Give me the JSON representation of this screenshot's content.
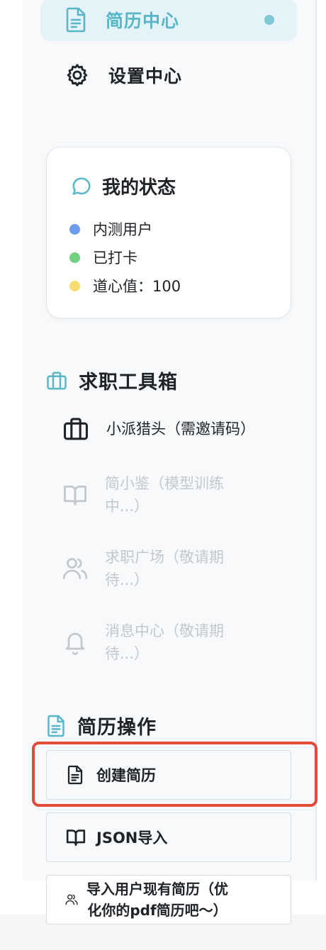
{
  "nav": {
    "items": [
      {
        "label": "简历中心",
        "icon": "document-icon",
        "active": true
      },
      {
        "label": "设置中心",
        "icon": "gear-icon",
        "active": false
      }
    ]
  },
  "status": {
    "title": "我的状态",
    "icon": "chat-bubble-icon",
    "rows": [
      {
        "text": "内测用户",
        "color": "#6f9cec"
      },
      {
        "text": "已打卡",
        "color": "#72d17e"
      },
      {
        "text": "道心值：100",
        "color": "#f7dc6f"
      }
    ]
  },
  "toolbox": {
    "title": "求职工具箱",
    "icon": "briefcase-icon",
    "items": [
      {
        "line1": "小派猎头（需邀请码）",
        "line2": "",
        "icon": "briefcase-icon",
        "enabled": true
      },
      {
        "line1": "简小鉴（模型训练",
        "line2": "中...）",
        "icon": "book-open-icon",
        "enabled": false
      },
      {
        "line1": "求职广场（敬请期",
        "line2": "待...）",
        "icon": "users-icon",
        "enabled": false
      },
      {
        "line1": "消息中心（敬请期",
        "line2": "待...）",
        "icon": "bell-icon",
        "enabled": false
      }
    ]
  },
  "resume_actions": {
    "title": "简历操作",
    "icon": "document-icon",
    "buttons": [
      {
        "label": "创建简历",
        "icon": "document-icon"
      },
      {
        "label": "JSON导入",
        "icon": "book-open-icon"
      },
      {
        "line1": "导入用户现有简历（优",
        "line2": "化你的pdf简历吧～）",
        "icon": "users-icon"
      }
    ]
  },
  "colors": {
    "accent": "#59b6c9",
    "active_bg": "#e4f3f7",
    "highlight": "#e14b3b",
    "disabled_text": "#c4c7cc"
  }
}
